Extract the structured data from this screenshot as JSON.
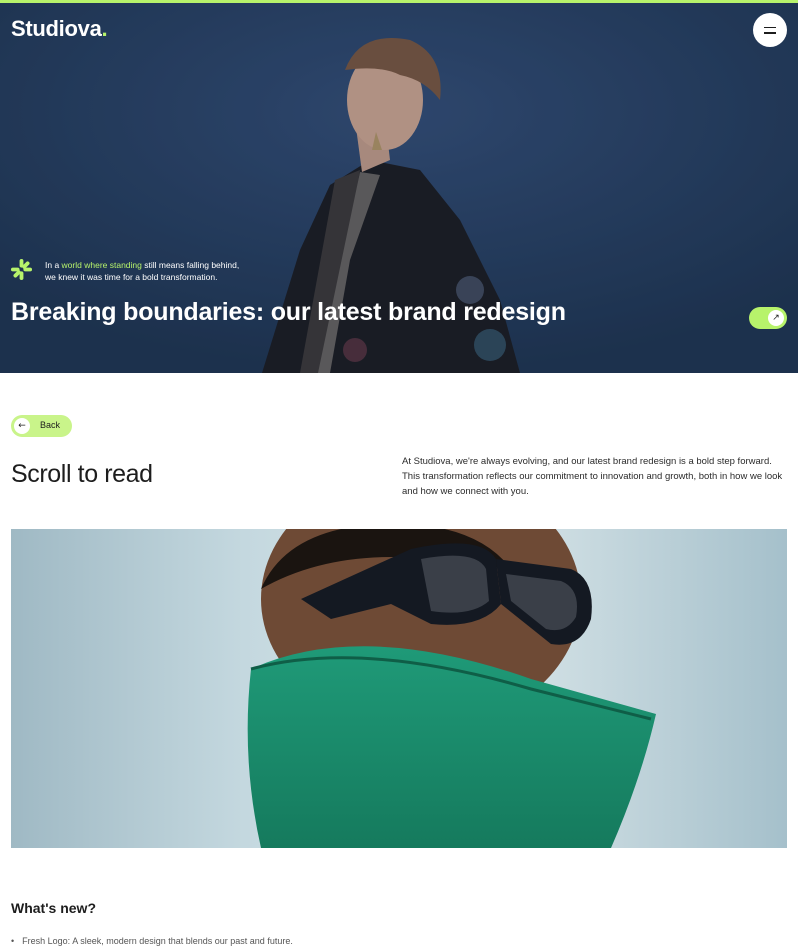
{
  "brand": {
    "name": "Studiova",
    "dot": "."
  },
  "header": {
    "menu_icon": "hamburger-icon"
  },
  "hero": {
    "intro_prefix": "In a ",
    "intro_highlight": "world where standing",
    "intro_middle": " still means falling behind,",
    "intro_line2": "we knew it was time for a bold transformation.",
    "title": "Breaking boundaries: our latest brand redesign",
    "asterisk_icon": "asterisk-icon",
    "arrow_icon": "arrow-up-right-icon"
  },
  "back": {
    "label": "Back",
    "icon": "arrow-left-icon"
  },
  "article": {
    "heading": "Scroll to read",
    "lead": "At Studiova, we're always evolving, and our latest brand redesign is a bold step forward. This transformation reflects our commitment to innovation and growth, both in how we look and how we connect with you."
  },
  "whats_new": {
    "heading": "What's new?",
    "items": [
      {
        "bullet": "•",
        "text": "Fresh Logo: A sleek, modern design that blends our past and future."
      }
    ]
  },
  "colors": {
    "accent": "#b7f36b",
    "hero_bg": "#29415f",
    "text": "#1d1d1d"
  }
}
